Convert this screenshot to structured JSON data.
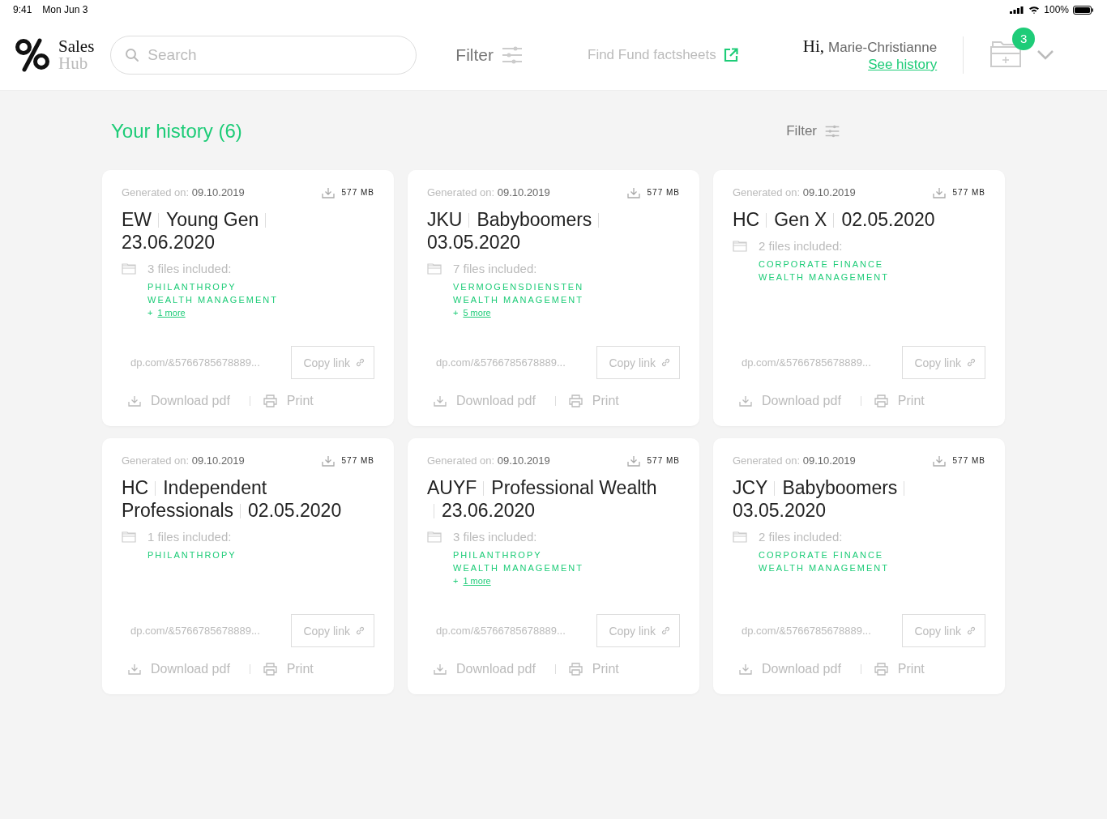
{
  "status_bar": {
    "time": "9:41",
    "date": "Mon Jun 3",
    "battery": "100%"
  },
  "header": {
    "logo": {
      "line1": "Sales",
      "line2": "Hub"
    },
    "search": {
      "placeholder": "Search"
    },
    "filter": "Filter",
    "factsheets": "Find Fund factsheets",
    "greeting": "Hi,",
    "user": "Marie-Christianne",
    "history_link": "See history",
    "cart_count": "3"
  },
  "history": {
    "title": "Your history (6)",
    "filter": "Filter"
  },
  "cards": [
    {
      "generated_label": "Generated on:",
      "date": "09.10.2019",
      "size": "577 MB",
      "title_parts": [
        "EW",
        "Young Gen",
        "23.06.2020"
      ],
      "files_label": "3 files included:",
      "files": [
        "PHILANTHROPY",
        "WEALTH MANAGEMENT"
      ],
      "more": {
        "prefix": "+",
        "link": "1 more"
      },
      "url": "dp.com/&5766785678889...",
      "copy": "Copy link",
      "download": "Download pdf",
      "print": "Print"
    },
    {
      "generated_label": "Generated on:",
      "date": "09.10.2019",
      "size": "577 MB",
      "title_parts": [
        "JKU",
        "Babyboomers",
        "03.05.2020"
      ],
      "files_label": "7 files included:",
      "files": [
        "VERMOGENSDIENSTEN",
        "WEALTH MANAGEMENT"
      ],
      "more": {
        "prefix": "+",
        "link": "5 more"
      },
      "url": "dp.com/&5766785678889...",
      "copy": "Copy link",
      "download": "Download pdf",
      "print": "Print"
    },
    {
      "generated_label": "Generated on:",
      "date": "09.10.2019",
      "size": "577 MB",
      "title_parts": [
        "HC",
        "Gen X",
        "02.05.2020"
      ],
      "files_label": "2 files included:",
      "files": [
        "CORPORATE FINANCE",
        "WEALTH MANAGEMENT"
      ],
      "url": "dp.com/&5766785678889...",
      "copy": "Copy link",
      "download": "Download pdf",
      "print": "Print"
    },
    {
      "generated_label": "Generated on:",
      "date": "09.10.2019",
      "size": "577 MB",
      "title_parts": [
        "HC",
        "Independent Professionals",
        "02.05.2020"
      ],
      "files_label": "1 files included:",
      "files": [
        "PHILANTHROPY"
      ],
      "url": "dp.com/&5766785678889...",
      "copy": "Copy link",
      "download": "Download pdf",
      "print": "Print"
    },
    {
      "generated_label": "Generated on:",
      "date": "09.10.2019",
      "size": "577 MB",
      "title_parts": [
        "AUYF",
        "Professional Wealth",
        "23.06.2020"
      ],
      "files_label": "3 files included:",
      "files": [
        "PHILANTHROPY",
        "WEALTH MANAGEMENT"
      ],
      "more": {
        "prefix": "+",
        "link": "1 more"
      },
      "url": "dp.com/&5766785678889...",
      "copy": "Copy link",
      "download": "Download pdf",
      "print": "Print"
    },
    {
      "generated_label": "Generated on:",
      "date": "09.10.2019",
      "size": "577 MB",
      "title_parts": [
        "JCY",
        "Babyboomers",
        "03.05.2020"
      ],
      "files_label": "2 files included:",
      "files": [
        "CORPORATE FINANCE",
        "WEALTH MANAGEMENT"
      ],
      "url": "dp.com/&5766785678889...",
      "copy": "Copy link",
      "download": "Download pdf",
      "print": "Print"
    }
  ]
}
